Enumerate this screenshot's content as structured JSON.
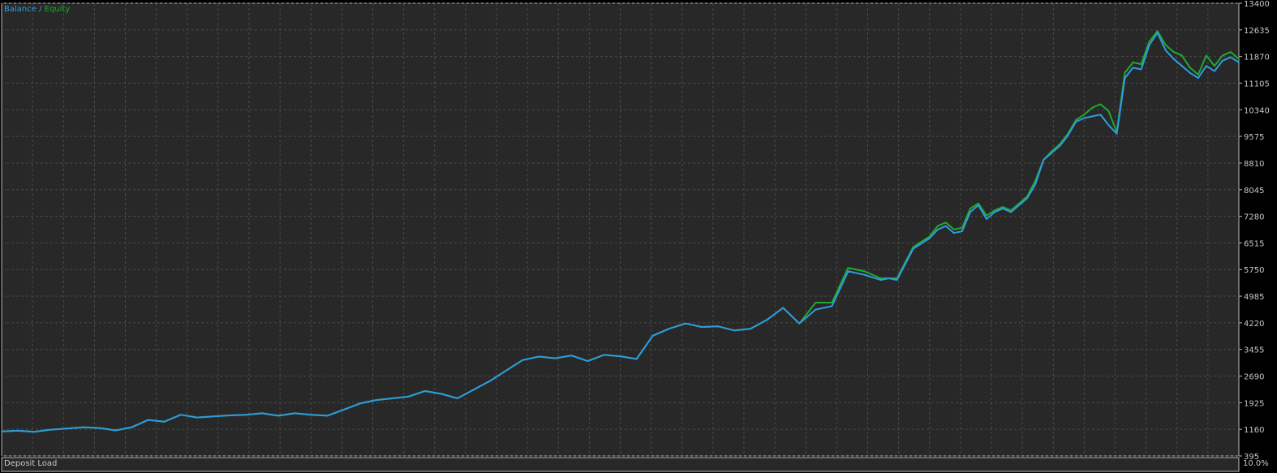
{
  "legend": {
    "balance": "Balance",
    "separator": " / ",
    "equity": "Equity"
  },
  "deposit_panel": {
    "label": "Deposit Load",
    "value": "10.0%"
  },
  "colors": {
    "background": "#282828",
    "grid": "#4a4a4a",
    "balance": "#2f9be0",
    "equity": "#1faa2f",
    "text": "#c8c8c8"
  },
  "chart_data": {
    "type": "line",
    "title": "",
    "xlabel": "",
    "ylabel": "",
    "ylim": [
      395,
      13400
    ],
    "y_ticks": [
      395,
      1160,
      1925,
      2690,
      3455,
      4220,
      4985,
      5750,
      6515,
      7280,
      8045,
      8810,
      9575,
      10340,
      11105,
      11870,
      12635,
      13400
    ],
    "grid": true,
    "legend_position": "top-left",
    "x": [
      0,
      20,
      40,
      60,
      80,
      100,
      120,
      140,
      160,
      180,
      200,
      220,
      240,
      260,
      280,
      300,
      320,
      340,
      360,
      380,
      400,
      420,
      440,
      460,
      480,
      500,
      520,
      540,
      560,
      580,
      600,
      620,
      640,
      660,
      680,
      700,
      720,
      740,
      760,
      780,
      800,
      820,
      840,
      860,
      880,
      900,
      920,
      940,
      960,
      980,
      1000,
      1020,
      1040,
      1060,
      1080,
      1090,
      1100,
      1120,
      1140,
      1150,
      1160,
      1170,
      1180,
      1190,
      1200,
      1210,
      1220,
      1230,
      1240,
      1250,
      1260,
      1270,
      1280,
      1290,
      1300,
      1310,
      1320,
      1330,
      1340,
      1350,
      1360,
      1370,
      1380,
      1390,
      1400,
      1410,
      1420,
      1430,
      1440,
      1450,
      1460,
      1470,
      1480,
      1490,
      1500,
      1510,
      1520
    ],
    "series": [
      {
        "name": "Balance",
        "values": [
          1100,
          1120,
          1090,
          1150,
          1180,
          1220,
          1200,
          1130,
          1220,
          1430,
          1380,
          1580,
          1500,
          1530,
          1560,
          1580,
          1620,
          1550,
          1620,
          1580,
          1550,
          1720,
          1900,
          2000,
          2050,
          2100,
          2260,
          2180,
          2050,
          2300,
          2550,
          2850,
          3150,
          3250,
          3200,
          3280,
          3120,
          3300,
          3260,
          3180,
          3850,
          4050,
          4200,
          4100,
          4120,
          4000,
          4050,
          4300,
          4650,
          4200,
          4600,
          4700,
          5700,
          5600,
          5450,
          5500,
          5450,
          6350,
          6650,
          6900,
          7000,
          6800,
          6850,
          7400,
          7600,
          7200,
          7400,
          7500,
          7400,
          7600,
          7800,
          8200,
          8900,
          9100,
          9300,
          9600,
          10000,
          10100,
          10150,
          10200,
          9900,
          9650,
          11250,
          11550,
          11500,
          12200,
          12550,
          12050,
          11800,
          11600,
          11400,
          11250,
          11600,
          11450,
          11750,
          11850,
          11700
        ]
      },
      {
        "name": "Equity",
        "values": [
          1100,
          1120,
          1090,
          1150,
          1180,
          1220,
          1200,
          1130,
          1220,
          1430,
          1380,
          1580,
          1500,
          1530,
          1560,
          1580,
          1620,
          1550,
          1620,
          1580,
          1550,
          1720,
          1900,
          2000,
          2050,
          2100,
          2260,
          2180,
          2050,
          2300,
          2550,
          2850,
          3150,
          3250,
          3200,
          3280,
          3120,
          3300,
          3260,
          3180,
          3850,
          4050,
          4200,
          4100,
          4120,
          4000,
          4050,
          4300,
          4650,
          4200,
          4800,
          4800,
          5800,
          5700,
          5500,
          5500,
          5500,
          6400,
          6700,
          7000,
          7100,
          6900,
          6950,
          7500,
          7650,
          7300,
          7450,
          7550,
          7450,
          7650,
          7850,
          8300,
          8900,
          9150,
          9350,
          9650,
          10050,
          10200,
          10400,
          10500,
          10300,
          9700,
          11400,
          11700,
          11650,
          12300,
          12600,
          12200,
          12000,
          11900,
          11550,
          11350,
          11900,
          11600,
          11900,
          12000,
          11800
        ]
      }
    ]
  }
}
